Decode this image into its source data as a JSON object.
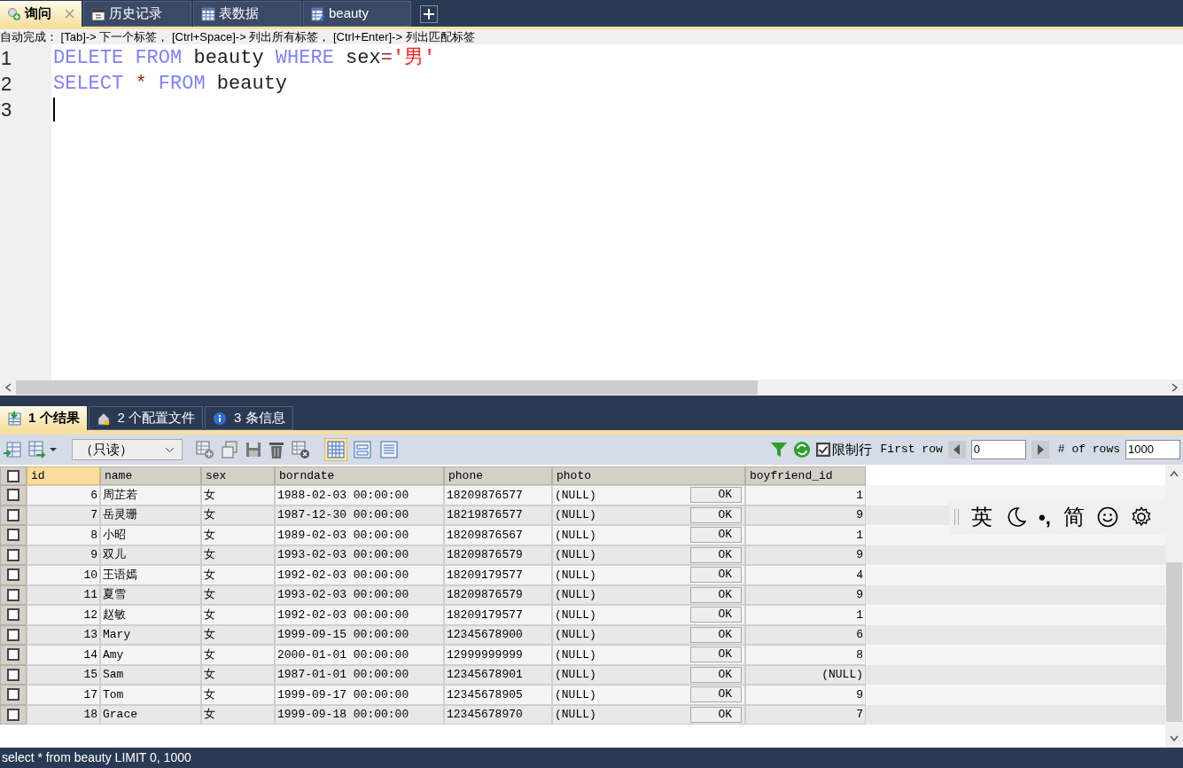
{
  "query_tabs": [
    {
      "label": "询问",
      "selected": true,
      "closable": true
    },
    {
      "label": "历史记录",
      "selected": false,
      "closable": false
    },
    {
      "label": "表数据",
      "selected": false,
      "closable": false
    },
    {
      "label": "beauty",
      "selected": false,
      "closable": false
    }
  ],
  "hint": "自动完成： [Tab]-> 下一个标签， [Ctrl+Space]-> 列出所有标签， [Ctrl+Enter]-> 列出匹配标签",
  "editor": {
    "lines": [
      {
        "number": "1",
        "tokens": [
          {
            "kind": "keyword",
            "text": "DELETE "
          },
          {
            "kind": "keyword",
            "text": "FROM "
          },
          {
            "kind": "ident",
            "text": "beauty "
          },
          {
            "kind": "keyword",
            "text": "WHERE "
          },
          {
            "kind": "ident",
            "text": "sex"
          },
          {
            "kind": "op",
            "text": "="
          },
          {
            "kind": "string",
            "text": "'男'"
          }
        ]
      },
      {
        "number": "2",
        "tokens": [
          {
            "kind": "keyword",
            "text": "SELECT "
          },
          {
            "kind": "op",
            "text": "* "
          },
          {
            "kind": "keyword",
            "text": "FROM "
          },
          {
            "kind": "ident",
            "text": "beauty"
          }
        ]
      },
      {
        "number": "3",
        "caret": true
      }
    ]
  },
  "result_tabs": [
    {
      "label": "1 个结果",
      "selected": true
    },
    {
      "label": "2 个配置文件",
      "selected": false
    },
    {
      "label": "3 条信息",
      "selected": false
    }
  ],
  "toolbar": {
    "mode_select": "（只读）",
    "views": [
      {
        "selected": true
      },
      {
        "selected": false
      },
      {
        "selected": false
      }
    ],
    "limit_rows": {
      "label": "限制行",
      "checked": true
    },
    "first_row_label": "First row",
    "first_row": "0",
    "rows_label": "# of rows",
    "rows": "1000"
  },
  "table": {
    "all_checked": false,
    "columns": [
      {
        "name": "id",
        "kind": "number",
        "selected": true
      },
      {
        "name": "name",
        "kind": "text",
        "selected": false
      },
      {
        "name": "sex",
        "kind": "text",
        "selected": false
      },
      {
        "name": "borndate",
        "kind": "text",
        "selected": false
      },
      {
        "name": "phone",
        "kind": "text",
        "selected": false
      },
      {
        "name": "photo",
        "kind": "blob",
        "selected": false
      },
      {
        "name": "boyfriend_id",
        "kind": "number",
        "selected": false
      }
    ],
    "rows": [
      {
        "checked": false,
        "cells": [
          "6",
          "周芷若",
          "女",
          "1988-02-03 00:00:00",
          "18209876577",
          "(NULL)",
          "1"
        ],
        "blob_button": "OK"
      },
      {
        "checked": false,
        "cells": [
          "7",
          "岳灵珊",
          "女",
          "1987-12-30 00:00:00",
          "18219876577",
          "(NULL)",
          "9"
        ],
        "blob_button": "OK"
      },
      {
        "checked": false,
        "cells": [
          "8",
          "小昭",
          "女",
          "1989-02-03 00:00:00",
          "18209876567",
          "(NULL)",
          "1"
        ],
        "blob_button": "OK"
      },
      {
        "checked": false,
        "cells": [
          "9",
          "双儿",
          "女",
          "1993-02-03 00:00:00",
          "18209876579",
          "(NULL)",
          "9"
        ],
        "blob_button": "OK"
      },
      {
        "checked": false,
        "cells": [
          "10",
          "王语嫣",
          "女",
          "1992-02-03 00:00:00",
          "18209179577",
          "(NULL)",
          "4"
        ],
        "blob_button": "OK"
      },
      {
        "checked": false,
        "cells": [
          "11",
          "夏雪",
          "女",
          "1993-02-03 00:00:00",
          "18209876579",
          "(NULL)",
          "9"
        ],
        "blob_button": "OK"
      },
      {
        "checked": false,
        "cells": [
          "12",
          "赵敏",
          "女",
          "1992-02-03 00:00:00",
          "18209179577",
          "(NULL)",
          "1"
        ],
        "blob_button": "OK"
      },
      {
        "checked": false,
        "cells": [
          "13",
          "Mary",
          "女",
          "1999-09-15 00:00:00",
          "12345678900",
          "(NULL)",
          "6"
        ],
        "blob_button": "OK"
      },
      {
        "checked": false,
        "cells": [
          "14",
          "Amy",
          "女",
          "2000-01-01 00:00:00",
          "12999999999",
          "(NULL)",
          "8"
        ],
        "blob_button": "OK"
      },
      {
        "checked": false,
        "cells": [
          "15",
          "Sam",
          "女",
          "1987-01-01 00:00:00",
          "12345678901",
          "(NULL)",
          "(NULL)"
        ],
        "blob_button": "OK"
      },
      {
        "checked": false,
        "cells": [
          "17",
          "Tom",
          "女",
          "1999-09-17 00:00:00",
          "12345678905",
          "(NULL)",
          "9"
        ],
        "blob_button": "OK"
      },
      {
        "checked": false,
        "cells": [
          "18",
          "Grace",
          "女",
          "1999-09-18 00:00:00",
          "12345678970",
          "(NULL)",
          "7"
        ],
        "blob_button": "OK"
      }
    ]
  },
  "ime_bar": {
    "language": "英",
    "punctuation": "•,",
    "script": "简"
  },
  "status_bar": "select * from beauty LIMIT 0, 1000"
}
